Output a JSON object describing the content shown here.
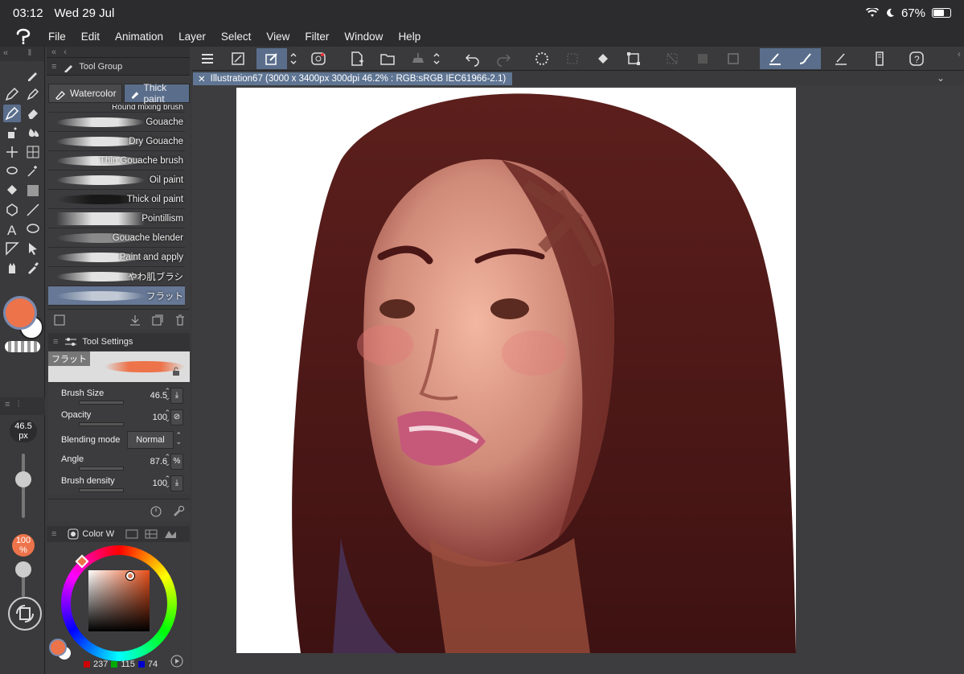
{
  "status": {
    "time": "03:12",
    "date": "Wed 29 Jul",
    "battery": "67%"
  },
  "menu": [
    "File",
    "Edit",
    "Animation",
    "Layer",
    "Select",
    "View",
    "Filter",
    "Window",
    "Help"
  ],
  "tool_group": {
    "header": "Tool Group",
    "tabs": [
      {
        "label": "Watercolor"
      },
      {
        "label": "Thick paint",
        "selected": true
      }
    ],
    "brushes": [
      {
        "label": "Round mixing brush"
      },
      {
        "label": "Gouache"
      },
      {
        "label": "Dry Gouache"
      },
      {
        "label": "Thin Gouache brush"
      },
      {
        "label": "Oil paint"
      },
      {
        "label": "Thick oil paint"
      },
      {
        "label": "Pointillism"
      },
      {
        "label": "Gouache blender"
      },
      {
        "label": "Paint and apply"
      },
      {
        "label": "やわ肌ブラシ"
      },
      {
        "label": "フラット",
        "selected": true
      }
    ]
  },
  "tool_settings": {
    "header": "Tool Settings",
    "preview_label": "フラット",
    "brush_size": {
      "label": "Brush Size",
      "value": "46.5"
    },
    "opacity": {
      "label": "Opacity",
      "value": "100"
    },
    "blending": {
      "label": "Blending mode",
      "value": "Normal"
    },
    "angle": {
      "label": "Angle",
      "value": "87.6"
    },
    "density": {
      "label": "Brush density",
      "value": "100"
    }
  },
  "left_strip": {
    "size_readout": "46.5",
    "size_unit": "px",
    "opacity_readout": "100",
    "opacity_unit": "%"
  },
  "color_panel": {
    "tab_label": "Color W",
    "r": "237",
    "g": "115",
    "b": "74",
    "main_color": "#ed734a"
  },
  "document": {
    "tab_label": "Illustration67 (3000 x 3400px 300dpi 46.2% : RGB:sRGB IEC61966-2.1)"
  },
  "colors": {
    "accent": "#5a6e8c",
    "panel": "#3c3c3e",
    "bg": "#2c2c2e"
  }
}
